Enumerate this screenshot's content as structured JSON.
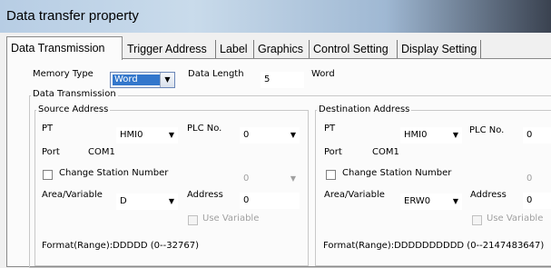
{
  "window": {
    "title": "Data transfer property"
  },
  "tabs": [
    {
      "label": "Data Transmission"
    },
    {
      "label": "Trigger Address"
    },
    {
      "label": "Label"
    },
    {
      "label": "Graphics"
    },
    {
      "label": "Control Setting"
    },
    {
      "label": "Display Setting"
    }
  ],
  "memory": {
    "type_label": "Memory Type",
    "type_value": "Word",
    "length_label": "Data Length",
    "length_value": "5",
    "unit": "Word"
  },
  "transmission": {
    "group_title": "Data Transmission"
  },
  "source": {
    "title": "Source Address",
    "pt_label": "PT",
    "pt_value": "HMI0",
    "plc_label": "PLC No.",
    "plc_value": "0",
    "port_label": "Port",
    "port_value": "COM1",
    "change_station": "Change Station Number",
    "station_value": "0",
    "area_label": "Area/Variable",
    "area_value": "D",
    "address_label": "Address",
    "address_value": "0",
    "use_variable": "Use Variable",
    "format": "Format(Range):DDDDD (0--32767)"
  },
  "destination": {
    "title": "Destination Address",
    "pt_label": "PT",
    "pt_value": "HMI0",
    "plc_label": "PLC No.",
    "plc_value": "0",
    "port_label": "Port",
    "port_value": "COM1",
    "change_station": "Change Station Number",
    "station_value": "0",
    "area_label": "Area/Variable",
    "area_value": "ERW0",
    "address_label": "Address",
    "address_value": "0",
    "use_variable": "Use Variable",
    "format": "Format(Range):DDDDDDDDDD (0--2147483647)"
  }
}
